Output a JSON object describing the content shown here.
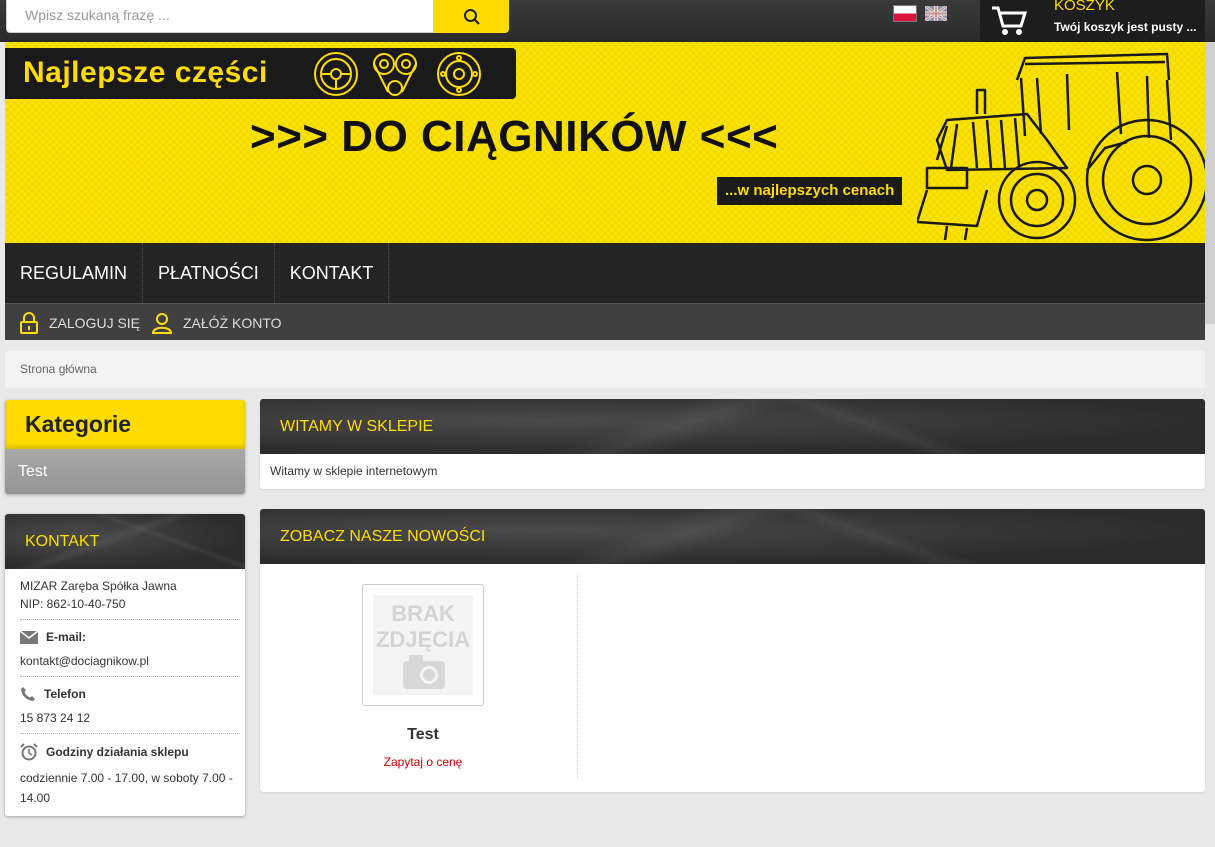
{
  "search": {
    "placeholder": "Wpisz szukaną frazę ..."
  },
  "languages": [
    "pl-flag",
    "en-flag"
  ],
  "cart": {
    "title": "KOSZYK",
    "status": "Twój koszyk jest pusty ..."
  },
  "banner": {
    "top_text": "Najlepsze części",
    "main_text": ">>> DO CIĄGNIKÓW <<<",
    "sub_text": "...w najlepszych cenach"
  },
  "nav": {
    "items": [
      {
        "label": "REGULAMIN"
      },
      {
        "label": "PŁATNOŚCI"
      },
      {
        "label": "KONTAKT"
      }
    ]
  },
  "account": {
    "login": "ZALOGUJ SIĘ",
    "register": "ZAŁÓŻ KONTO"
  },
  "breadcrumb": {
    "home": "Strona główna"
  },
  "categories": {
    "title": "Kategorie",
    "items": [
      {
        "label": "Test"
      }
    ]
  },
  "contact": {
    "title": "KONTAKT",
    "company": "MIZAR Zaręba Spółka Jawna",
    "nip": "NIP: 862-10-40-750",
    "email_label": "E-mail:",
    "email": "kontakt@dociagnikow.pl",
    "phone_label": "Telefon",
    "phone": "15 873 24 12",
    "hours_label": "Godziny działania sklepu",
    "hours": "codziennie 7.00 - 17.00, w soboty 7.00 - 14.00"
  },
  "welcome": {
    "title": "WITAMY W SKLEPIE",
    "text": "Witamy w sklepie internetowym"
  },
  "news": {
    "title": "ZOBACZ NASZE NOWOŚCI",
    "products": [
      {
        "name": "Test",
        "price_label": "Zapytaj o cenę",
        "image_text": [
          "BRAK",
          "ZDJĘCIA"
        ]
      }
    ]
  },
  "colors": {
    "accent": "#ffdc00",
    "dark": "#242424",
    "price": "#cc0000"
  }
}
